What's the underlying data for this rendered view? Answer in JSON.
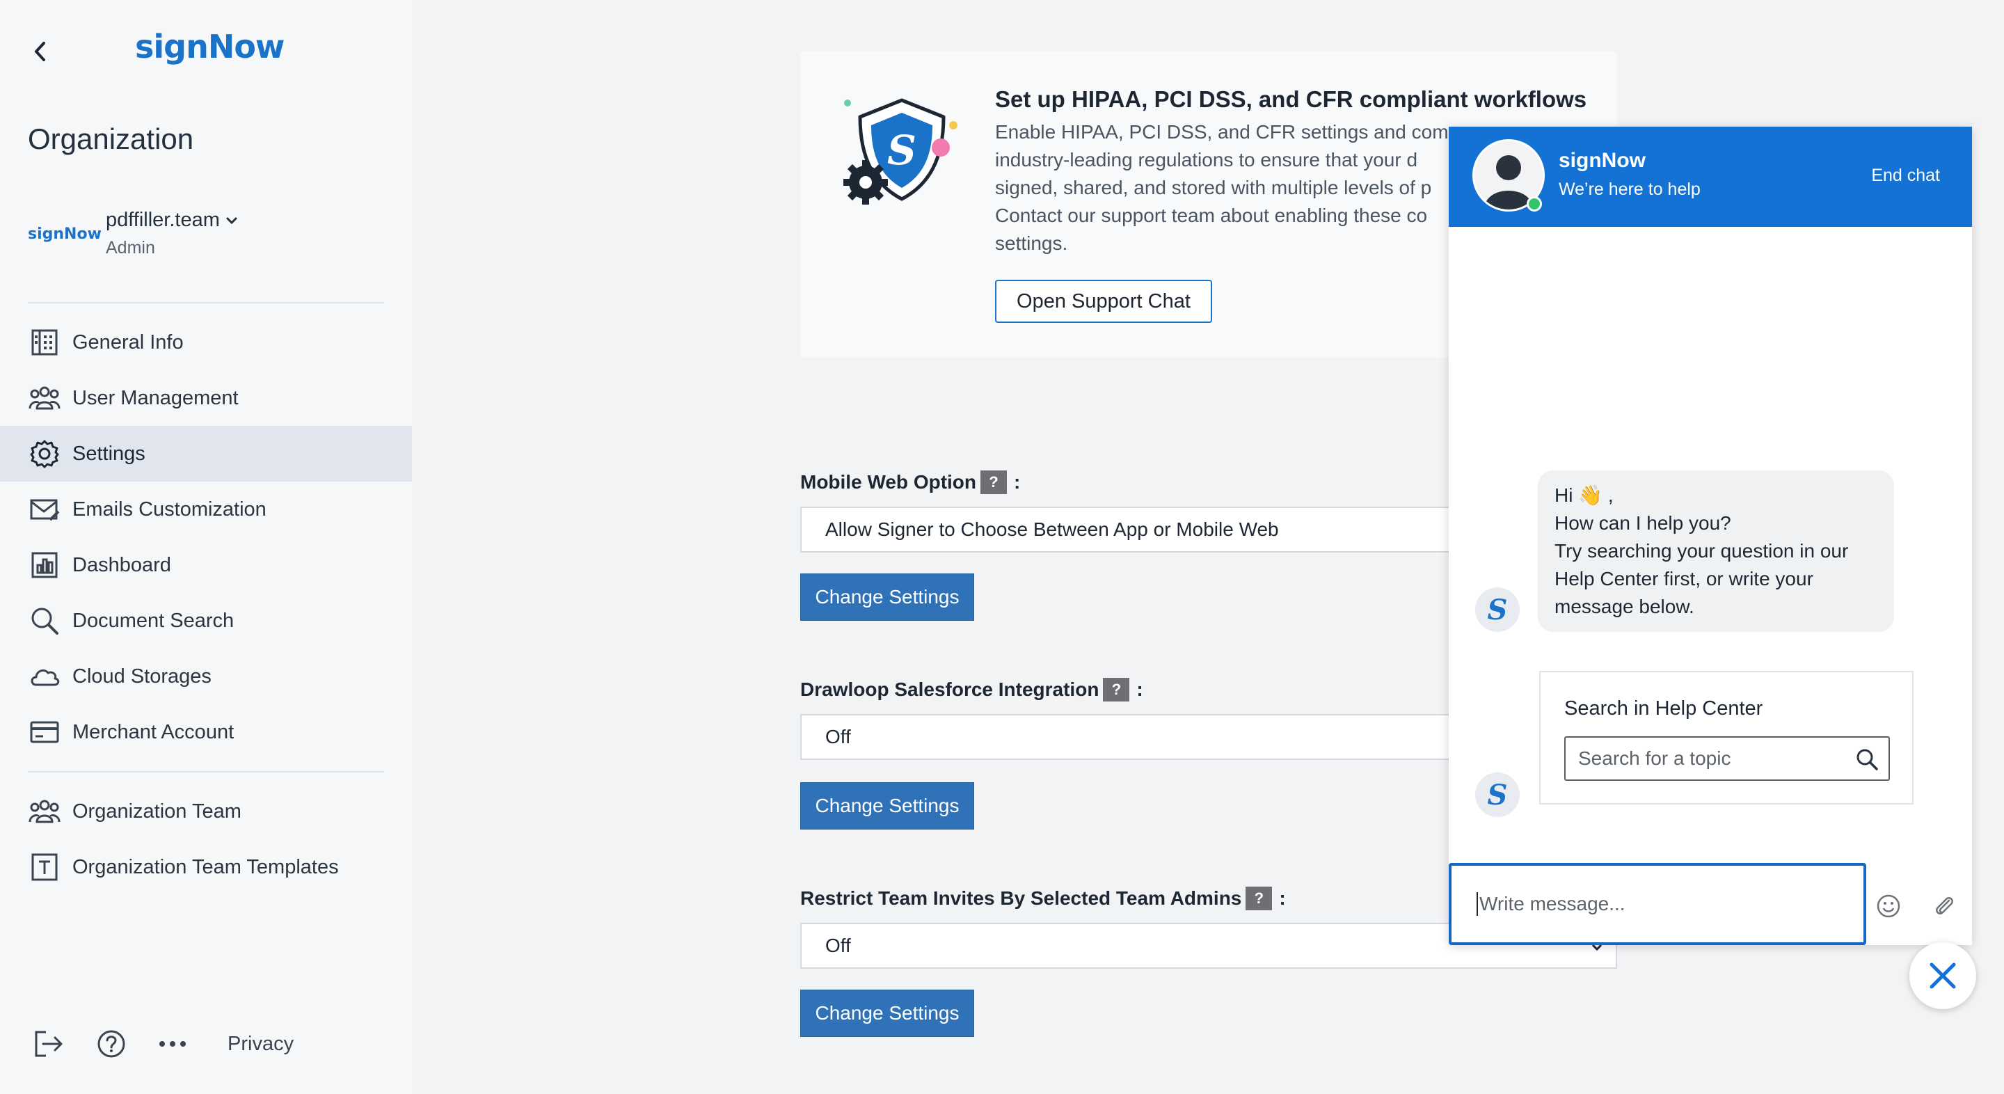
{
  "app": {
    "logo": "signNow",
    "brand_color": "#1a73c9"
  },
  "sidebar": {
    "section_title": "Organization",
    "team": {
      "logo": "signNow",
      "name": "pdffiller.team",
      "role": "Admin"
    },
    "items": [
      {
        "label": "General Info",
        "icon": "building-icon"
      },
      {
        "label": "User Management",
        "icon": "users-icon"
      },
      {
        "label": "Settings",
        "icon": "gear-icon",
        "active": true
      },
      {
        "label": "Emails Customization",
        "icon": "envelope-icon"
      },
      {
        "label": "Dashboard",
        "icon": "bar-chart-icon"
      },
      {
        "label": "Document Search",
        "icon": "search-icon"
      },
      {
        "label": "Cloud Storages",
        "icon": "cloud-icon"
      },
      {
        "label": "Merchant Account",
        "icon": "credit-card-icon"
      }
    ],
    "team_items": [
      {
        "label": "Organization Team",
        "icon": "users-icon"
      },
      {
        "label": "Organization Team Templates",
        "icon": "template-icon"
      }
    ],
    "footer": {
      "privacy_label": "Privacy"
    }
  },
  "promo": {
    "title": "Set up HIPAA, PCI DSS, and CFR compliant workflows",
    "lines": [
      "Enable HIPAA, PCI DSS, and CFR settings and comp",
      "industry-leading regulations to ensure that your d",
      "signed, shared, and stored with multiple levels of p",
      "Contact our support team about enabling these co",
      "settings."
    ],
    "button_label": "Open Support Chat"
  },
  "settings": [
    {
      "label": "Mobile Web Option",
      "colon": ":",
      "value": "Allow Signer to Choose Between App or Mobile Web",
      "button": "Change Settings"
    },
    {
      "label": "Drawloop Salesforce Integration",
      "colon": ":",
      "value": "Off",
      "button": "Change Settings"
    },
    {
      "label": "Restrict Team Invites By Selected Team Admins",
      "colon": ":",
      "value": "Off",
      "button": "Change Settings"
    }
  ],
  "help_mark": "?",
  "chat": {
    "title": "signNow",
    "subtitle": "We’re here to help",
    "end_chat": "End chat",
    "header_color": "#1372d4",
    "greeting": {
      "line1": "Hi 👋 ,",
      "line2": "How can I help you?",
      "line3": "Try searching your question in our",
      "line4": "Help Center first, or write your",
      "line5": "message below."
    },
    "help_center": {
      "title": "Search in Help Center",
      "placeholder": "Search for a topic"
    },
    "composer_placeholder": "Write message..."
  }
}
